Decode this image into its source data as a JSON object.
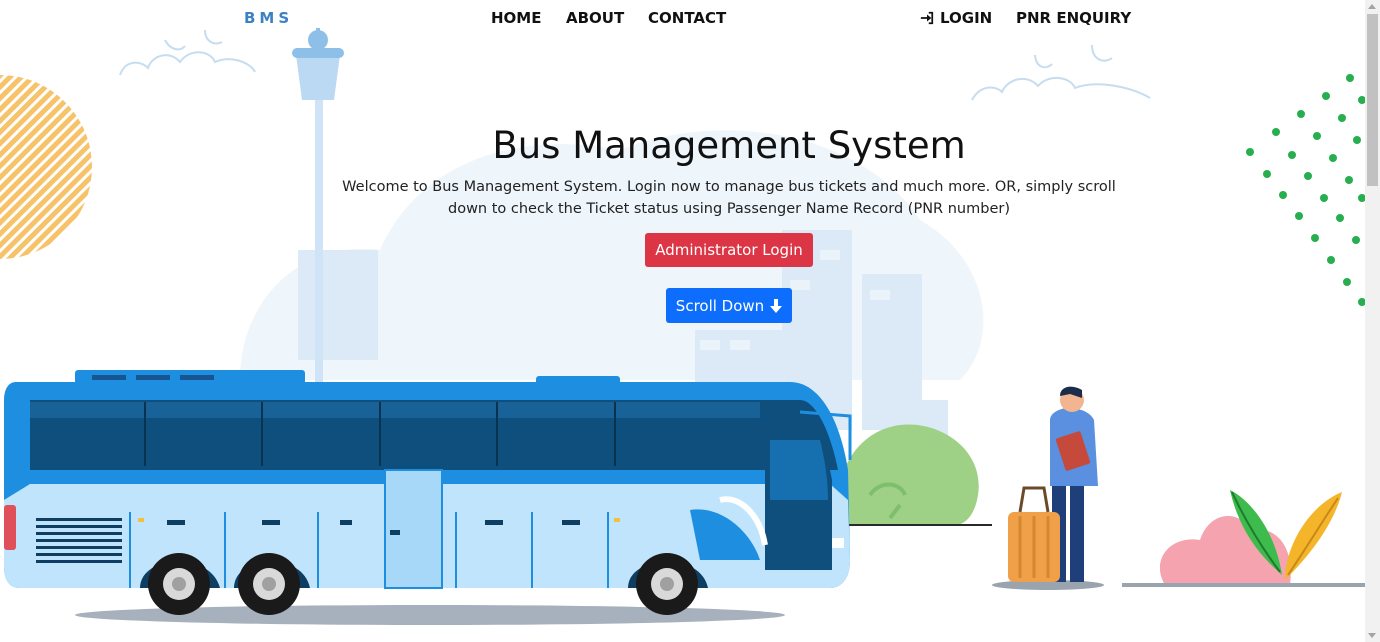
{
  "nav": {
    "brand": "BMS",
    "home": "HOME",
    "about": "ABOUT",
    "contact": "CONTACT",
    "login": "LOGIN",
    "login_icon": "sign-in-icon",
    "pnr": "PNR ENQUIRY"
  },
  "hero": {
    "title": "Bus Management System",
    "description": "Welcome to Bus Management System. Login now to manage bus tickets and much more. OR, simply scroll down to check the Ticket status using Passenger Name Record (PNR number)",
    "admin_button": "Administrator Login",
    "scroll_button": "Scroll Down",
    "scroll_icon": "arrow-down-icon"
  },
  "colors": {
    "brand": "#3b82c4",
    "admin_button": "#dc3545",
    "scroll_button": "#0d6efd",
    "bus_blue": "#1e8fe0"
  }
}
